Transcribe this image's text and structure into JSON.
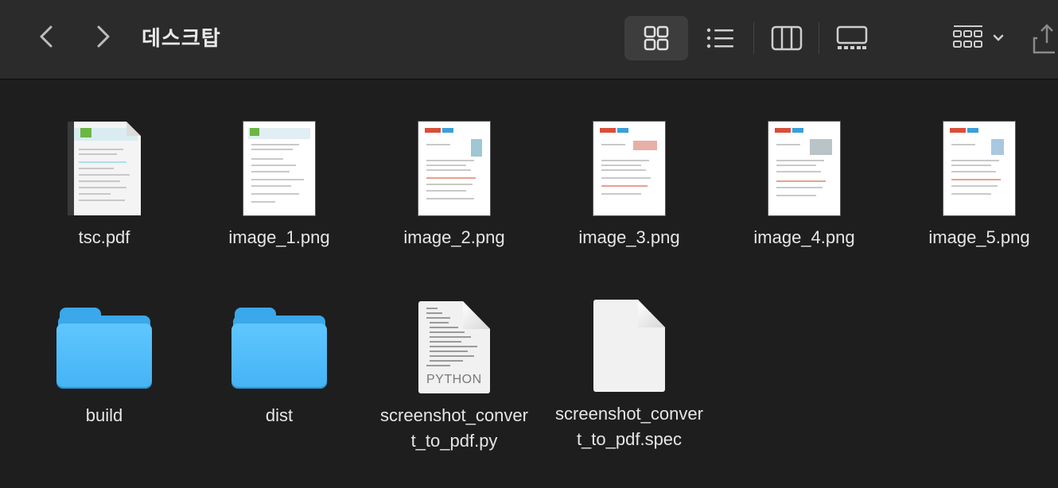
{
  "toolbar": {
    "title": "데스크탑",
    "back_icon": "chevron-left-icon",
    "forward_icon": "chevron-right-icon",
    "view_modes": [
      "icon-view",
      "list-view",
      "column-view",
      "gallery-view"
    ],
    "active_view": "icon-view",
    "group_icon": "group-by-icon",
    "share_icon": "share-icon"
  },
  "files": [
    {
      "name": "tsc.pdf",
      "kind": "pdf"
    },
    {
      "name": "image_1.png",
      "kind": "png"
    },
    {
      "name": "image_2.png",
      "kind": "png"
    },
    {
      "name": "image_3.png",
      "kind": "png"
    },
    {
      "name": "image_4.png",
      "kind": "png"
    },
    {
      "name": "image_5.png",
      "kind": "png"
    },
    {
      "name": "build",
      "kind": "folder"
    },
    {
      "name": "dist",
      "kind": "folder"
    },
    {
      "name": "screenshot_convert_to_pdf.py",
      "kind": "python",
      "badge": "PYTHON"
    },
    {
      "name": "screenshot_convert_to_pdf.spec",
      "kind": "document"
    }
  ],
  "colors": {
    "background": "#1e1e1e",
    "toolbar": "#2b2b2b",
    "folder": "#45b4f5"
  }
}
